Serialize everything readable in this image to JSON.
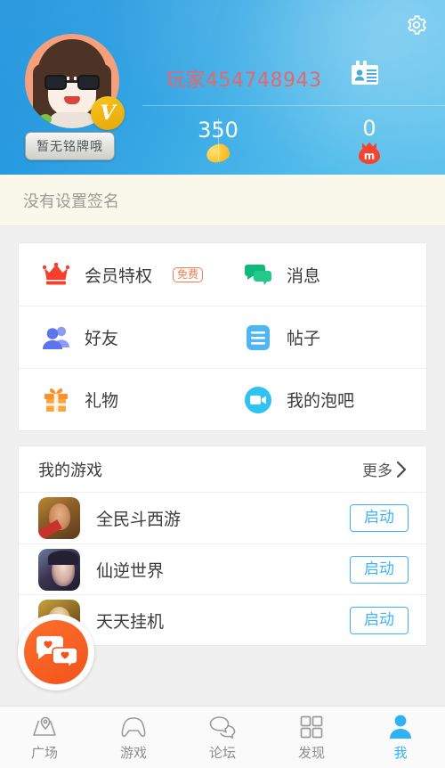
{
  "header": {
    "username": "玩家454748943",
    "username_color": "#e4686f",
    "nameplate": "暂无铭牌哦",
    "vip_badge": "V",
    "settings_icon": "gear-icon",
    "idcard_icon": "id-card-icon",
    "stats": [
      {
        "value": "350",
        "icon": "bean-coin-icon"
      },
      {
        "value": "0",
        "icon": "money-bag-icon",
        "bag_letter": "m"
      }
    ]
  },
  "signature": {
    "text": "没有设置签名"
  },
  "menu": {
    "rows": [
      [
        {
          "label": "会员特权",
          "icon": "crown-icon",
          "badge": "免费",
          "badge_color": "#fa7a4f",
          "icon_color": "#f4402c"
        },
        {
          "label": "消息",
          "icon": "message-bubble-icon",
          "icon_color": "#1ec07a"
        }
      ],
      [
        {
          "label": "好友",
          "icon": "friends-icon",
          "icon_color": "#6e83f0"
        },
        {
          "label": "帖子",
          "icon": "post-list-icon",
          "icon_color": "#4fb6f5"
        }
      ],
      [
        {
          "label": "礼物",
          "icon": "gift-icon",
          "icon_color": "#f9912c"
        },
        {
          "label": "我的泡吧",
          "icon": "video-camera-icon",
          "icon_color": "#2ec3f2"
        }
      ]
    ]
  },
  "games": {
    "title": "我的游戏",
    "more_label": "更多",
    "more_icon": "chevron-right-icon",
    "items": [
      {
        "name": "全民斗西游",
        "icon": "game-icon-monkey-king",
        "action": "启动"
      },
      {
        "name": "仙逆世界",
        "icon": "game-icon-fantasy-girl",
        "action": "启动"
      },
      {
        "name": "天天挂机",
        "icon": "game-icon-idle",
        "action": "启动"
      }
    ]
  },
  "fab": {
    "icon": "chat-hearts-icon"
  },
  "tabbar": {
    "active_color": "#2fb2f4",
    "items": [
      {
        "label": "广场",
        "icon": "map-pin-icon",
        "active": false
      },
      {
        "label": "游戏",
        "icon": "gamepad-icon",
        "active": false
      },
      {
        "label": "论坛",
        "icon": "chat-bubbles-icon",
        "active": false
      },
      {
        "label": "发现",
        "icon": "grid-squares-icon",
        "active": false
      },
      {
        "label": "我",
        "icon": "person-icon",
        "active": true
      }
    ]
  }
}
